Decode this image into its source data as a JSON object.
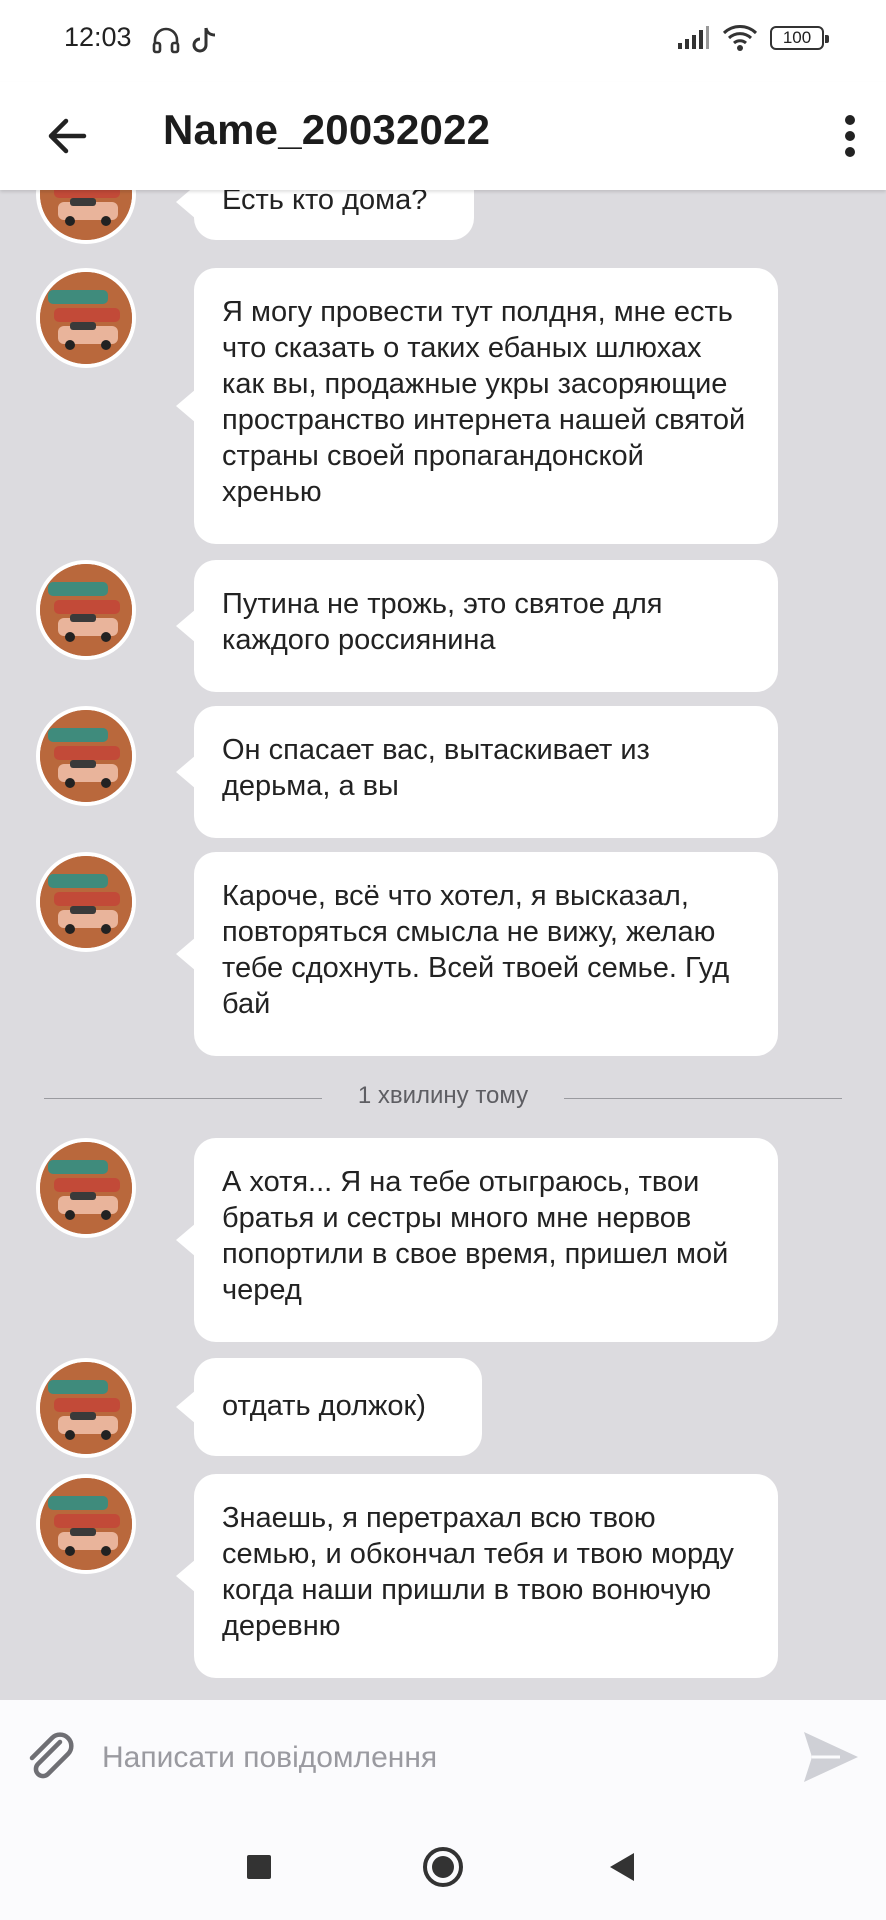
{
  "status_bar": {
    "time": "12:03",
    "battery": "100",
    "icons": [
      "headphones-icon",
      "tiktok-icon",
      "signal-icon",
      "wifi-icon",
      "battery-icon"
    ]
  },
  "header": {
    "title": "Name_20032022",
    "back_icon": "arrow-left-icon",
    "menu_icon": "more-vertical-icon"
  },
  "messages": [
    {
      "text": "Есть кто дома?"
    },
    {
      "text": "Я могу провести тут полдня, мне есть что сказать о таких ебаных шлюхах как вы, продажные укры засоряющие пространство интернета нашей святой страны своей пропагандонской хренью"
    },
    {
      "text": "Путина не трожь, это святое для каждого россиянина"
    },
    {
      "text": "Он спасает вас, вытаскивает из дерьма, а вы"
    },
    {
      "text": "Кароче, всё что хотел, я высказал, повторяться смысла не вижу, желаю тебе сдохнуть. Всей твоей семье. Гуд бай"
    },
    {
      "text": "А хотя... Я на тебе отыграюсь, твои братья и сестры много мне нервов попортили в свое время, пришел мой черед"
    },
    {
      "text": "отдать должок)"
    },
    {
      "text": "Знаешь, я перетрахал всю твою семью, и обкончал тебя и твою морду когда наши пришли в твою вонючую деревню"
    }
  ],
  "divider": {
    "text": "1 хвилину тому"
  },
  "composer": {
    "placeholder": "Написати повідомлення",
    "attach_icon": "paperclip-icon",
    "send_icon": "send-icon"
  },
  "nav_bar": {
    "icons": [
      "recents-square-icon",
      "home-circle-icon",
      "back-triangle-icon"
    ]
  },
  "colors": {
    "chat_background": "#dcdbdf",
    "bubble": "#ffffff",
    "header": "#ffffff"
  }
}
